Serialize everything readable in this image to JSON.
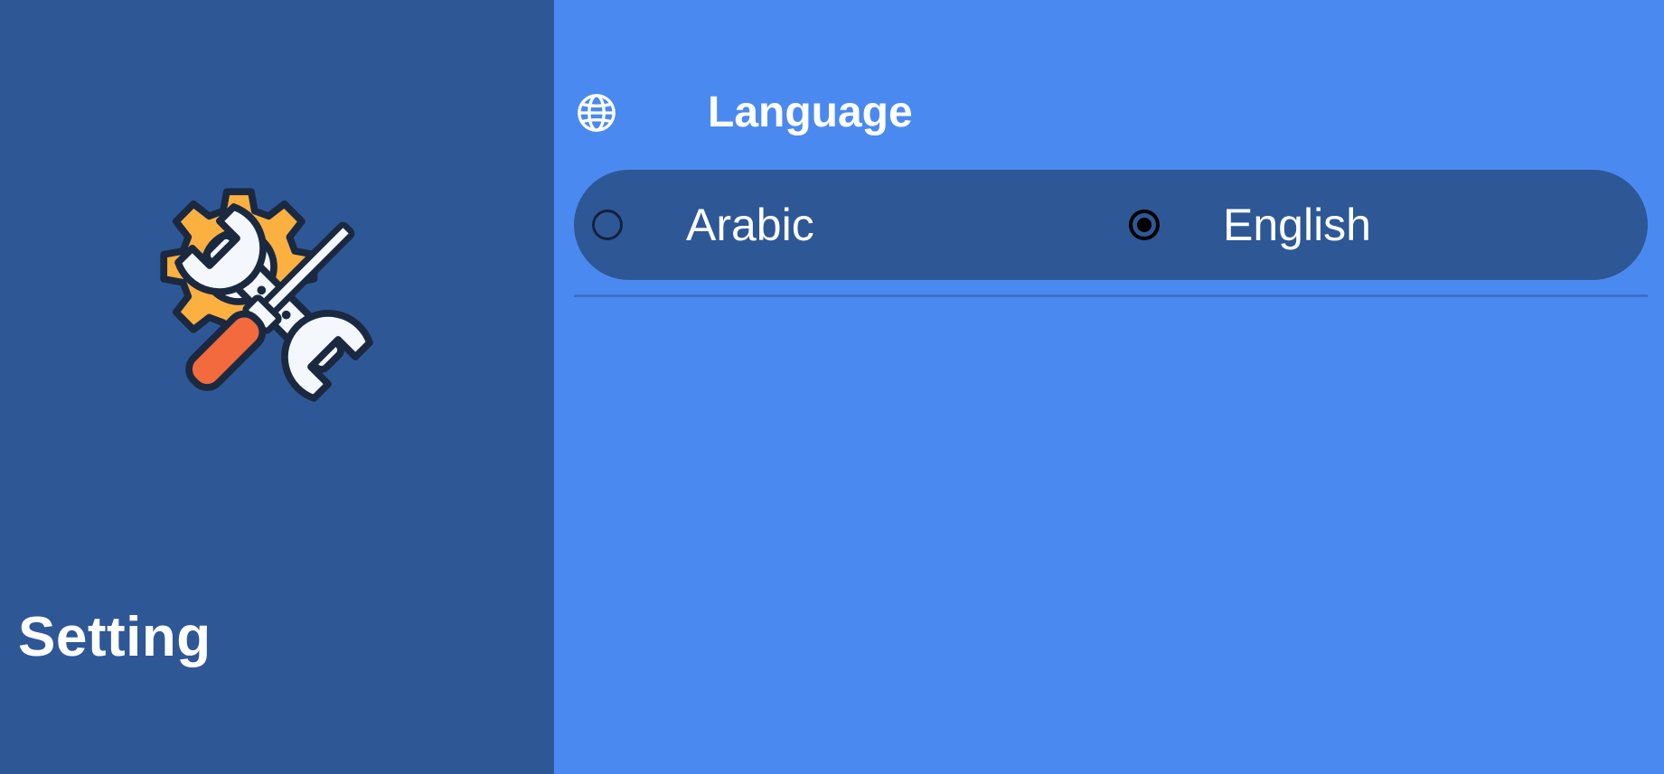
{
  "sidebar": {
    "title": "Setting",
    "icon": "settings-tools-icon"
  },
  "language_section": {
    "title": "Language",
    "icon": "globe-icon",
    "options": [
      {
        "label": "Arabic",
        "selected": false
      },
      {
        "label": "English",
        "selected": true
      }
    ]
  },
  "colors": {
    "sidebar_bg": "#2e5796",
    "main_bg": "#4a8af0",
    "pill_bg": "#2e5796",
    "gear": "#fbb040",
    "screwdriver_handle": "#f26a3d"
  }
}
